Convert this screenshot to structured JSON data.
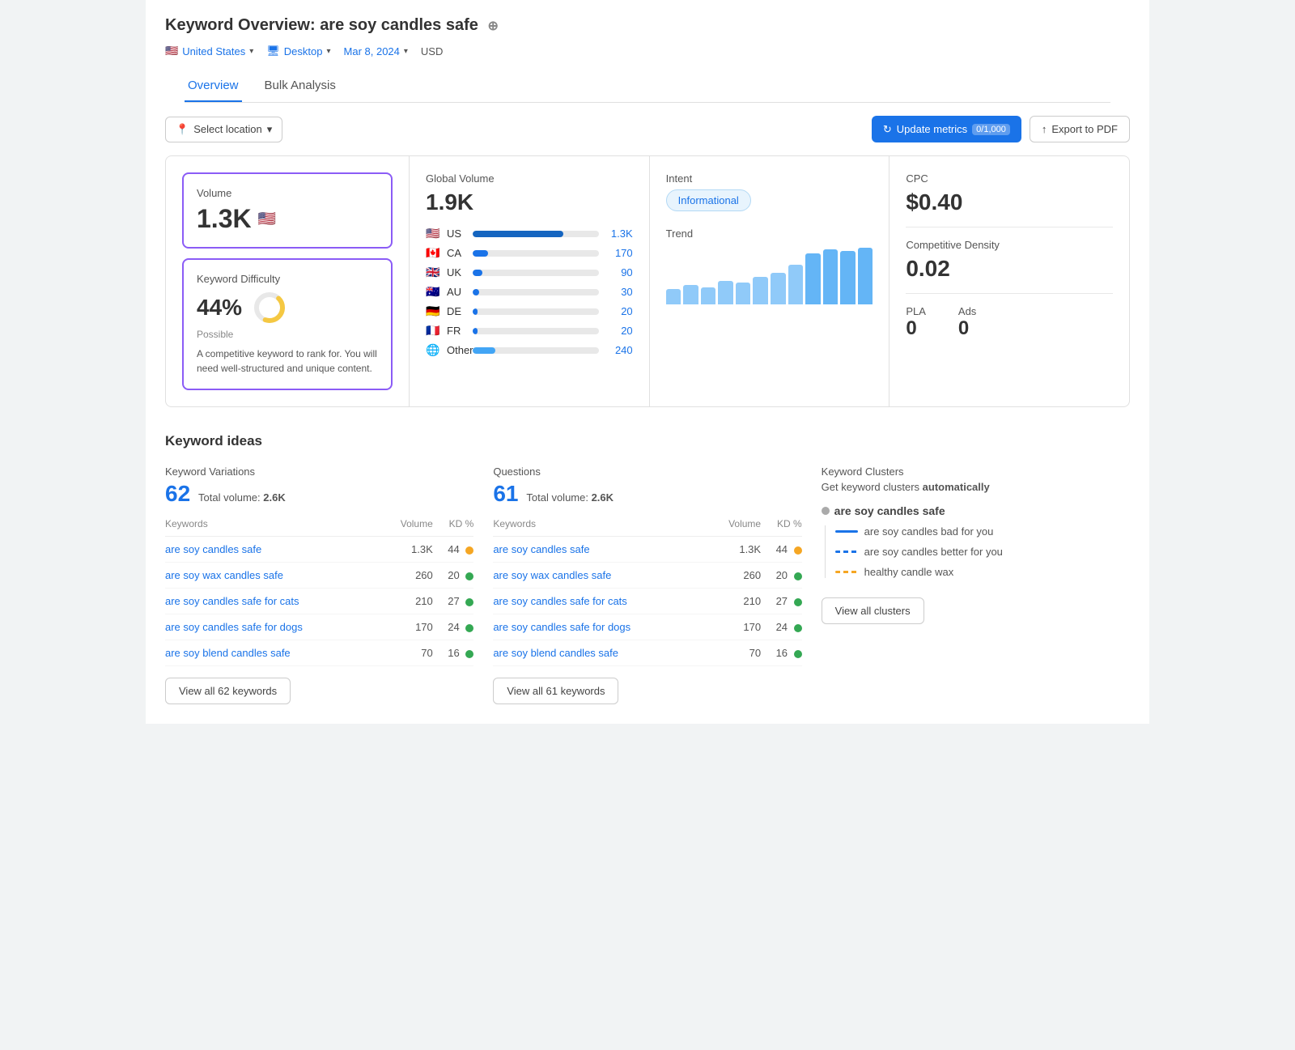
{
  "header": {
    "title_prefix": "Keyword Overview:",
    "keyword": "are soy candles safe",
    "plus_label": "⊕",
    "filters": {
      "country": "United States",
      "device": "Desktop",
      "date": "Mar 8, 2024",
      "currency": "USD"
    },
    "tabs": [
      "Overview",
      "Bulk Analysis"
    ],
    "active_tab": "Overview"
  },
  "toolbar": {
    "location_label": "Select location",
    "update_label": "Update metrics",
    "update_counter": "0/1,000",
    "export_label": "Export to PDF"
  },
  "volume_card": {
    "label": "Volume",
    "value": "1.3K",
    "flag": "🇺🇸"
  },
  "kd_card": {
    "label": "Keyword Difficulty",
    "value": "44%",
    "difficulty_text": "Possible",
    "description": "A competitive keyword to rank for. You will need well-structured and unique content."
  },
  "global_volume": {
    "label": "Global Volume",
    "value": "1.9K",
    "countries": [
      {
        "flag": "🇺🇸",
        "code": "US",
        "bar_pct": 72,
        "value": "1.3K",
        "color": "#1565c0"
      },
      {
        "flag": "🇨🇦",
        "code": "CA",
        "bar_pct": 12,
        "value": "170",
        "color": "#1a73e8"
      },
      {
        "flag": "🇬🇧",
        "code": "UK",
        "bar_pct": 8,
        "value": "90",
        "color": "#1a73e8"
      },
      {
        "flag": "🇦🇺",
        "code": "AU",
        "bar_pct": 5,
        "value": "30",
        "color": "#1a73e8"
      },
      {
        "flag": "🇩🇪",
        "code": "DE",
        "bar_pct": 4,
        "value": "20",
        "color": "#1a73e8"
      },
      {
        "flag": "🇫🇷",
        "code": "FR",
        "bar_pct": 4,
        "value": "20",
        "color": "#1a73e8"
      },
      {
        "flag": "🌐",
        "code": "Other",
        "bar_pct": 18,
        "value": "240",
        "color": "#42a5f5"
      }
    ]
  },
  "intent": {
    "label": "Intent",
    "badge": "Informational"
  },
  "trend": {
    "label": "Trend",
    "bars": [
      20,
      25,
      22,
      30,
      28,
      35,
      40,
      50,
      65,
      70,
      68,
      72
    ]
  },
  "cpc": {
    "label": "CPC",
    "value": "$0.40"
  },
  "competitive_density": {
    "label": "Competitive Density",
    "value": "0.02"
  },
  "pla": {
    "label": "PLA",
    "value": "0"
  },
  "ads": {
    "label": "Ads",
    "value": "0"
  },
  "keyword_ideas": {
    "section_title": "Keyword ideas",
    "variations": {
      "subtitle": "Keyword Variations",
      "count": "62",
      "volume_label": "Total volume:",
      "volume_value": "2.6K",
      "col_keywords": "Keywords",
      "col_volume": "Volume",
      "col_kd": "KD %",
      "rows": [
        {
          "keyword": "are soy candles safe",
          "volume": "1.3K",
          "kd": "44",
          "dot": "yellow"
        },
        {
          "keyword": "are soy wax candles safe",
          "volume": "260",
          "kd": "20",
          "dot": "green"
        },
        {
          "keyword": "are soy candles safe for cats",
          "volume": "210",
          "kd": "27",
          "dot": "green"
        },
        {
          "keyword": "are soy candles safe for dogs",
          "volume": "170",
          "kd": "24",
          "dot": "green"
        },
        {
          "keyword": "are soy blend candles safe",
          "volume": "70",
          "kd": "16",
          "dot": "green"
        }
      ],
      "view_all": "View all 62 keywords"
    },
    "questions": {
      "subtitle": "Questions",
      "count": "61",
      "volume_label": "Total volume:",
      "volume_value": "2.6K",
      "col_keywords": "Keywords",
      "col_volume": "Volume",
      "col_kd": "KD %",
      "rows": [
        {
          "keyword": "are soy candles safe",
          "volume": "1.3K",
          "kd": "44",
          "dot": "yellow"
        },
        {
          "keyword": "are soy wax candles safe",
          "volume": "260",
          "kd": "20",
          "dot": "green"
        },
        {
          "keyword": "are soy candles safe for cats",
          "volume": "210",
          "kd": "27",
          "dot": "green"
        },
        {
          "keyword": "are soy candles safe for dogs",
          "volume": "170",
          "kd": "24",
          "dot": "green"
        },
        {
          "keyword": "are soy blend candles safe",
          "volume": "70",
          "kd": "16",
          "dot": "green"
        }
      ],
      "view_all": "View all 61 keywords"
    },
    "clusters": {
      "subtitle": "Keyword Clusters",
      "desc_prefix": "Get keyword clusters ",
      "desc_bold": "automatically",
      "root": "are soy candles safe",
      "items": [
        {
          "label": "are soy candles bad for you",
          "line": "blue"
        },
        {
          "label": "are soy candles better for you",
          "line": "stripe"
        },
        {
          "label": "healthy candle wax",
          "line": "yellow"
        }
      ],
      "view_all": "View all clusters"
    }
  }
}
